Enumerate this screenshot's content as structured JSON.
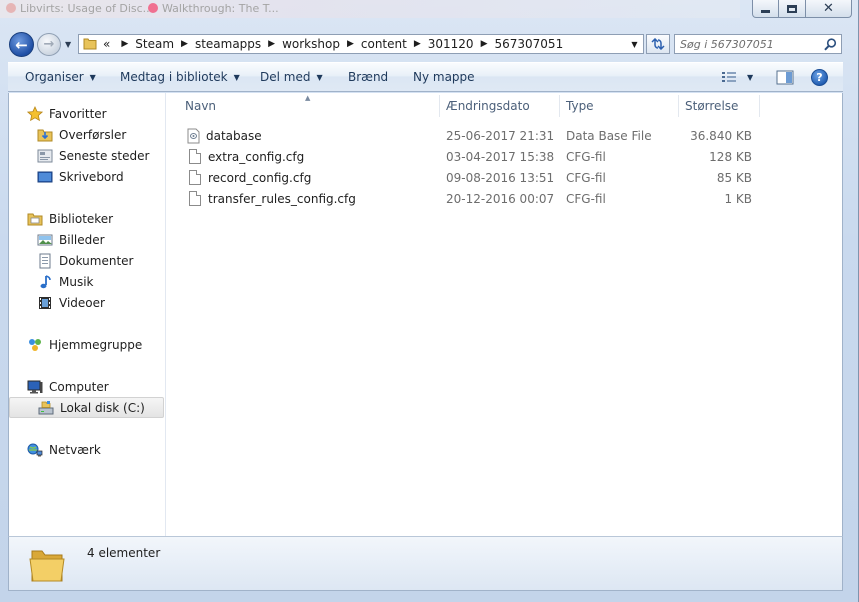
{
  "background_tabs": [
    "Libvirts: Usage of Disc...",
    "Walkthrough: The T..."
  ],
  "window": {
    "caption": {
      "minimize": "",
      "maximize": "",
      "close": "✕"
    }
  },
  "address_bar": {
    "overflow": "«",
    "crumbs": [
      "Steam",
      "steamapps",
      "workshop",
      "content",
      "301120",
      "567307051"
    ],
    "search_placeholder": "Søg i 567307051"
  },
  "command_bar": {
    "items": [
      "Organiser",
      "Medtag i bibliotek",
      "Del med",
      "Brænd",
      "Ny mappe"
    ],
    "has_dropdown": [
      true,
      true,
      true,
      false,
      false
    ],
    "help": "?"
  },
  "nav_pane": {
    "favorites": {
      "label": "Favoritter",
      "items": [
        "Overførsler",
        "Seneste steder",
        "Skrivebord"
      ]
    },
    "libraries": {
      "label": "Biblioteker",
      "items": [
        "Billeder",
        "Dokumenter",
        "Musik",
        "Videoer"
      ]
    },
    "homegroup": {
      "label": "Hjemmegruppe"
    },
    "computer": {
      "label": "Computer",
      "items": [
        "Lokal disk (C:)"
      ]
    },
    "network": {
      "label": "Netværk"
    }
  },
  "file_list": {
    "columns": [
      "Navn",
      "Ændringsdato",
      "Type",
      "Størrelse"
    ],
    "rows": [
      {
        "name": "database",
        "date": "25-06-2017 21:31",
        "type": "Data Base File",
        "size": "36.840 KB",
        "icon": "database-file-icon"
      },
      {
        "name": "extra_config.cfg",
        "date": "03-04-2017 15:38",
        "type": "CFG-fil",
        "size": "128 KB",
        "icon": "file-icon"
      },
      {
        "name": "record_config.cfg",
        "date": "09-08-2016 13:51",
        "type": "CFG-fil",
        "size": "85 KB",
        "icon": "file-icon"
      },
      {
        "name": "transfer_rules_config.cfg",
        "date": "20-12-2016 00:07",
        "type": "CFG-fil",
        "size": "1 KB",
        "icon": "file-icon"
      }
    ]
  },
  "details_pane": {
    "count_text": "4 elementer"
  },
  "colors": {
    "accent": "#1e395b",
    "selection": "#e4e4e4",
    "frame": "#c9d9ee"
  }
}
